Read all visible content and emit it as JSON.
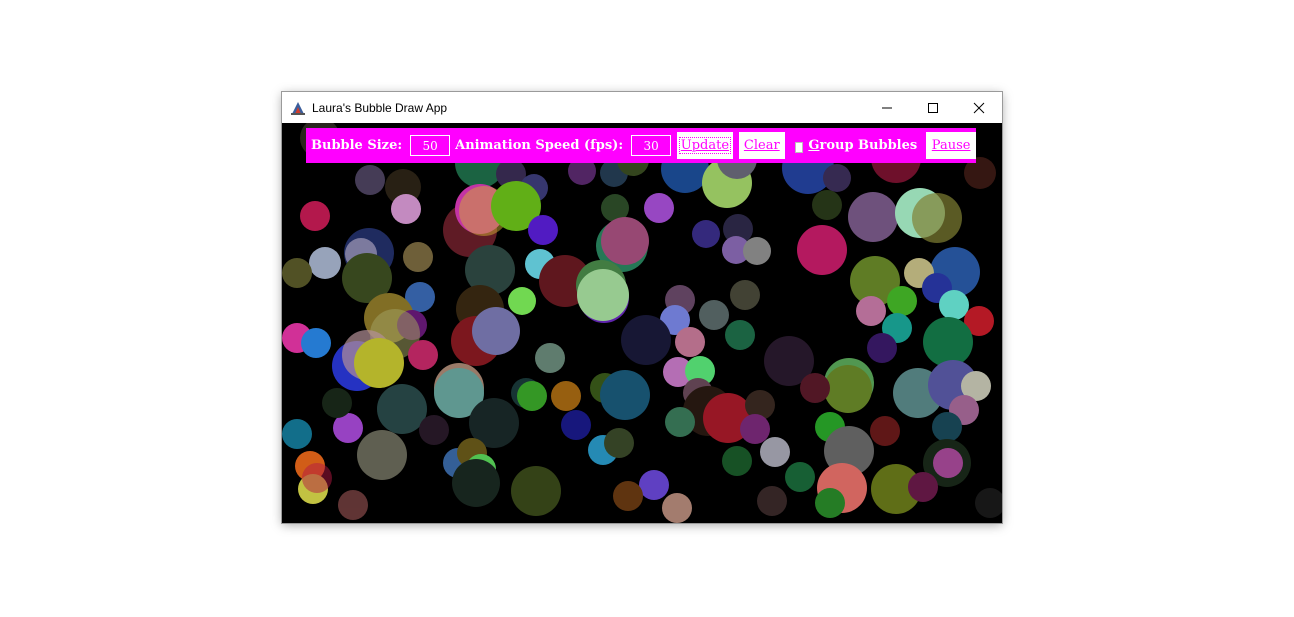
{
  "window": {
    "title": "Laura's Bubble Draw App",
    "controls": {
      "minimize_icon": "minimize-icon",
      "maximize_icon": "maximize-icon",
      "close_icon": "close-icon"
    }
  },
  "toolbar": {
    "bubble_size_label": "Bubble Size:",
    "bubble_size_value": "50",
    "animation_speed_label": "Animation Speed (fps):",
    "animation_speed_value": "30",
    "update_label": "Update",
    "clear_label": "Clear",
    "group_bubbles_label": "Group Bubbles",
    "group_bubbles_checked": false,
    "pause_label": "Pause"
  },
  "colors": {
    "toolbar_bg": "#ff00ff",
    "toolbar_text": "#ffffff",
    "canvas_bg": "#000000",
    "button_bg": "#ffffff",
    "button_text": "#ff00ff"
  }
}
